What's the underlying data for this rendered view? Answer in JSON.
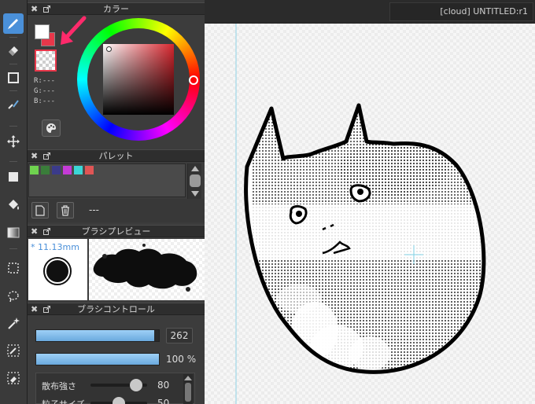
{
  "document": {
    "tab_label": "[cloud] UNTITLED:r1"
  },
  "color_panel": {
    "title": "カラー",
    "r_label": "R:---",
    "g_label": "G:---",
    "b_label": "B:---",
    "main_color": "#ffffff",
    "sub_color": "#e8374a",
    "arrow_color": "#ff2a6b"
  },
  "palette_panel": {
    "title": "パレット",
    "name": "---",
    "swatches": [
      "#6fd34f",
      "#3a7d3a",
      "#3b3b8a",
      "#c43bd6",
      "#3bd6d6",
      "#e05555"
    ]
  },
  "brush_preview_panel": {
    "title": "ブラシプレビュー",
    "size_label": "* 11.13mm"
  },
  "brush_control_panel": {
    "title": "ブラシコントロール",
    "size_value": "262",
    "size_fill": 0.96,
    "opacity_value": "100 %",
    "opacity_fill": 1.0,
    "scatter_label": "散布強さ",
    "scatter_value": "80",
    "scatter_fill": 0.8,
    "particle_label": "粒子サイズ",
    "particle_value": "50",
    "particle_fill": 0.5
  }
}
